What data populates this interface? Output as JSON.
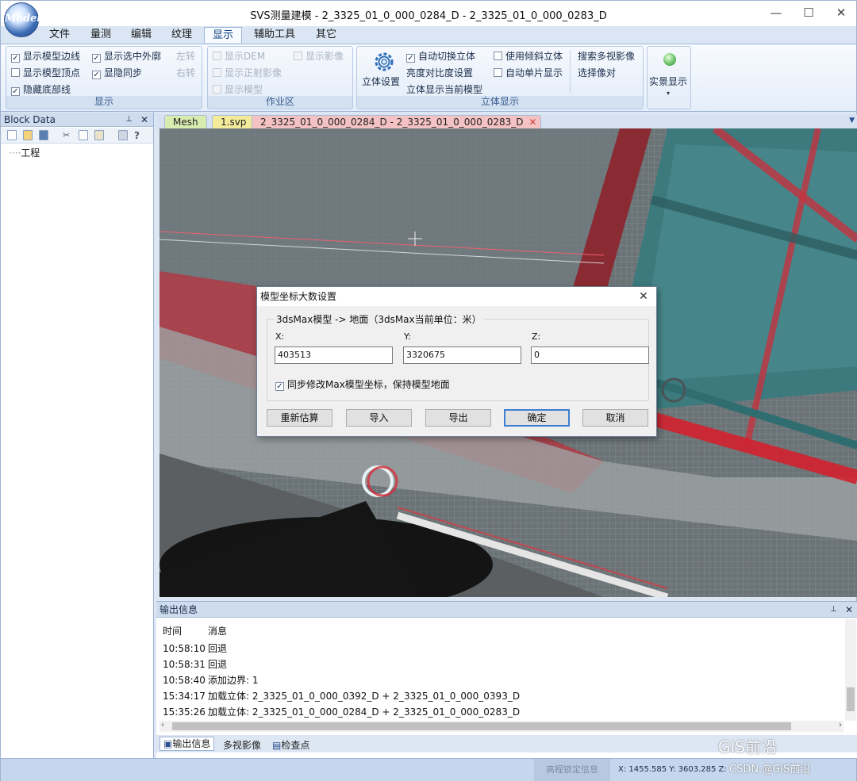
{
  "window": {
    "title": "SVS测量建模 - 2_3325_01_0_000_0284_D - 2_3325_01_0_000_0283_D",
    "logo_text": "Model"
  },
  "menu": [
    "文件",
    "量测",
    "编辑",
    "纹理",
    "显示",
    "辅助工具",
    "其它"
  ],
  "active_menu": "显示",
  "ribbon": {
    "display": {
      "caption": "显示",
      "show_edges": "显示模型边线",
      "show_outline": "显示选中外廓",
      "show_vertices": "显示模型顶点",
      "sync_hide": "显隐同步",
      "hide_bottom": "隐藏底部线",
      "rotate_left": "左转",
      "rotate_right": "右转"
    },
    "workarea": {
      "caption": "作业区",
      "show_dem": "显示DEM",
      "show_image": "显示影像",
      "show_ortho": "显示正射影像",
      "show_model": "显示模型"
    },
    "stereo": {
      "caption": "立体显示",
      "settings": "立体设置",
      "auto_switch": "自动切换立体",
      "brightness": "亮度对比度设置",
      "show_current_model": "立体显示当前模型",
      "use_oblique": "使用倾斜立体",
      "auto_single": "自动单片显示",
      "search_multi": "搜索多视影像",
      "select_pair": "选择像对"
    },
    "realview": {
      "label": "实景显示"
    }
  },
  "left_pane": {
    "title": "Block Data",
    "tree_root": "工程"
  },
  "doc_tabs": [
    "Mesh",
    "1.svp",
    "2_3325_01_0_000_0284_D - 2_3325_01_0_000_0283_D"
  ],
  "dialog": {
    "title": "模型坐标大数设置",
    "group_label": "3dsMax模型 -> 地面（3dsMax当前单位：米）",
    "x_label": "X:",
    "y_label": "Y:",
    "z_label": "Z:",
    "x_value": "403513",
    "y_value": "3320675",
    "z_value": "0",
    "sync_label": "同步修改Max模型坐标，保持模型地面",
    "buttons": [
      "重新估算",
      "导入",
      "导出",
      "确定",
      "取消"
    ]
  },
  "output": {
    "title": "输出信息",
    "header_time": "时间",
    "header_msg": "消息",
    "rows": [
      {
        "time": "10:58:10",
        "msg": "回退"
      },
      {
        "time": "10:58:31",
        "msg": "回退"
      },
      {
        "time": "10:58:40",
        "msg": "添加边界: 1"
      },
      {
        "time": "15:34:17",
        "msg": "加载立体: 2_3325_01_0_000_0392_D + 2_3325_01_0_000_0393_D"
      },
      {
        "time": "15:35:26",
        "msg": "加载立体: 2_3325_01_0_000_0284_D + 2_3325_01_0_000_0283_D"
      }
    ],
    "tabs": [
      "输出信息",
      "多视影像",
      "检查点"
    ]
  },
  "status": {
    "mode_text": "高程锁定信息",
    "coords": "X: 1455.585  Y: 3603.285  Z:"
  },
  "watermark": {
    "main": "GIS前沿",
    "sub": "CSDN @GIS前沿"
  }
}
